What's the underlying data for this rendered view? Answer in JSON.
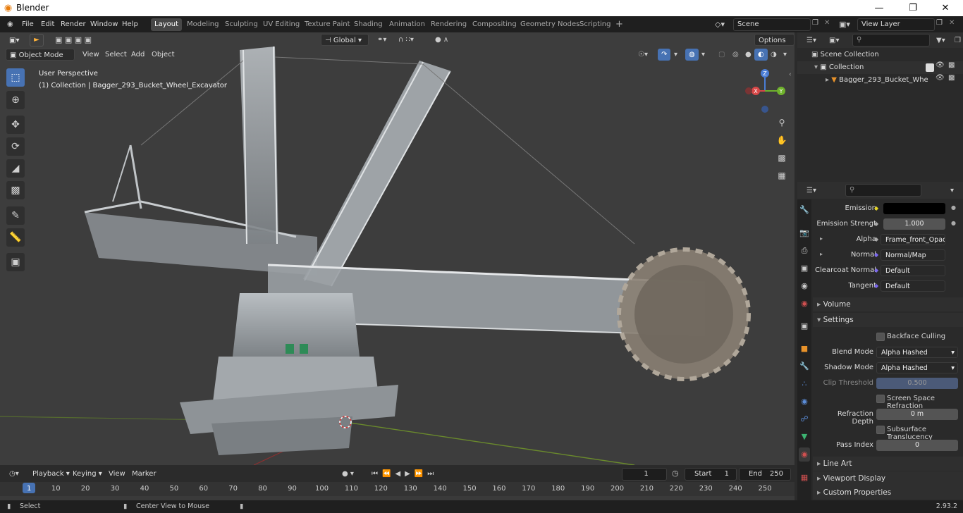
{
  "window": {
    "title": "Blender"
  },
  "menu": [
    "File",
    "Edit",
    "Render",
    "Window",
    "Help"
  ],
  "workspaces": [
    "Layout",
    "Modeling",
    "Sculpting",
    "UV Editing",
    "Texture Paint",
    "Shading",
    "Animation",
    "Rendering",
    "Compositing",
    "Geometry Nodes",
    "Scripting"
  ],
  "active_workspace": "Layout",
  "scene": {
    "name": "Scene",
    "view_layer": "View Layer"
  },
  "viewport": {
    "mode": "Object Mode",
    "header_menus": [
      "View",
      "Select",
      "Add",
      "Object"
    ],
    "transform_orientation": "Global",
    "options_label": "Options",
    "overlay_title": "User Perspective",
    "overlay_subtitle": "(1) Collection | Bagger_293_Bucket_Wheel_Excavator",
    "gizmo": {
      "z": "Z",
      "x": "X",
      "y": "Y"
    }
  },
  "outliner": {
    "root": "Scene Collection",
    "collection": "Collection",
    "object": "Bagger_293_Bucket_Whe"
  },
  "properties": {
    "emission_label": "Emission",
    "emission_strength_label": "Emission Strengt",
    "emission_strength_value": "1.000",
    "alpha_label": "Alpha",
    "alpha_value": "Frame_front_Opacit...",
    "normal_label": "Normal",
    "normal_value": "Normal/Map",
    "clearcoat_label": "Clearcoat Normal",
    "clearcoat_value": "Default",
    "tangent_label": "Tangent",
    "tangent_value": "Default",
    "volume_section": "Volume",
    "settings_section": "Settings",
    "backface_label": "Backface Culling",
    "blend_mode_label": "Blend Mode",
    "blend_mode_value": "Alpha Hashed",
    "shadow_mode_label": "Shadow Mode",
    "shadow_mode_value": "Alpha Hashed",
    "clip_label": "Clip Threshold",
    "clip_value": "0.500",
    "ssr_label": "Screen Space Refraction",
    "refraction_depth_label": "Refraction Depth",
    "refraction_depth_value": "0 m",
    "sss_label": "Subsurface Translucency",
    "pass_index_label": "Pass Index",
    "pass_index_value": "0",
    "line_art_section": "Line Art",
    "viewport_display_section": "Viewport Display",
    "custom_props_section": "Custom Properties"
  },
  "timeline": {
    "menus": [
      "Playback",
      "Keying",
      "View",
      "Marker"
    ],
    "current_frame": "1",
    "start_label": "Start",
    "start_value": "1",
    "end_label": "End",
    "end_value": "250",
    "ticks": [
      "1",
      "10",
      "20",
      "30",
      "40",
      "50",
      "60",
      "70",
      "80",
      "90",
      "100",
      "110",
      "120",
      "130",
      "140",
      "150",
      "160",
      "170",
      "180",
      "190",
      "200",
      "210",
      "220",
      "230",
      "240",
      "250"
    ]
  },
  "statusbar": {
    "select": "Select",
    "center": "Center View to Mouse",
    "version": "2.93.2"
  },
  "colors": {
    "accent": "#4772b3",
    "active_tab": "#474747",
    "viewport_bg": "#3d3d3d"
  }
}
